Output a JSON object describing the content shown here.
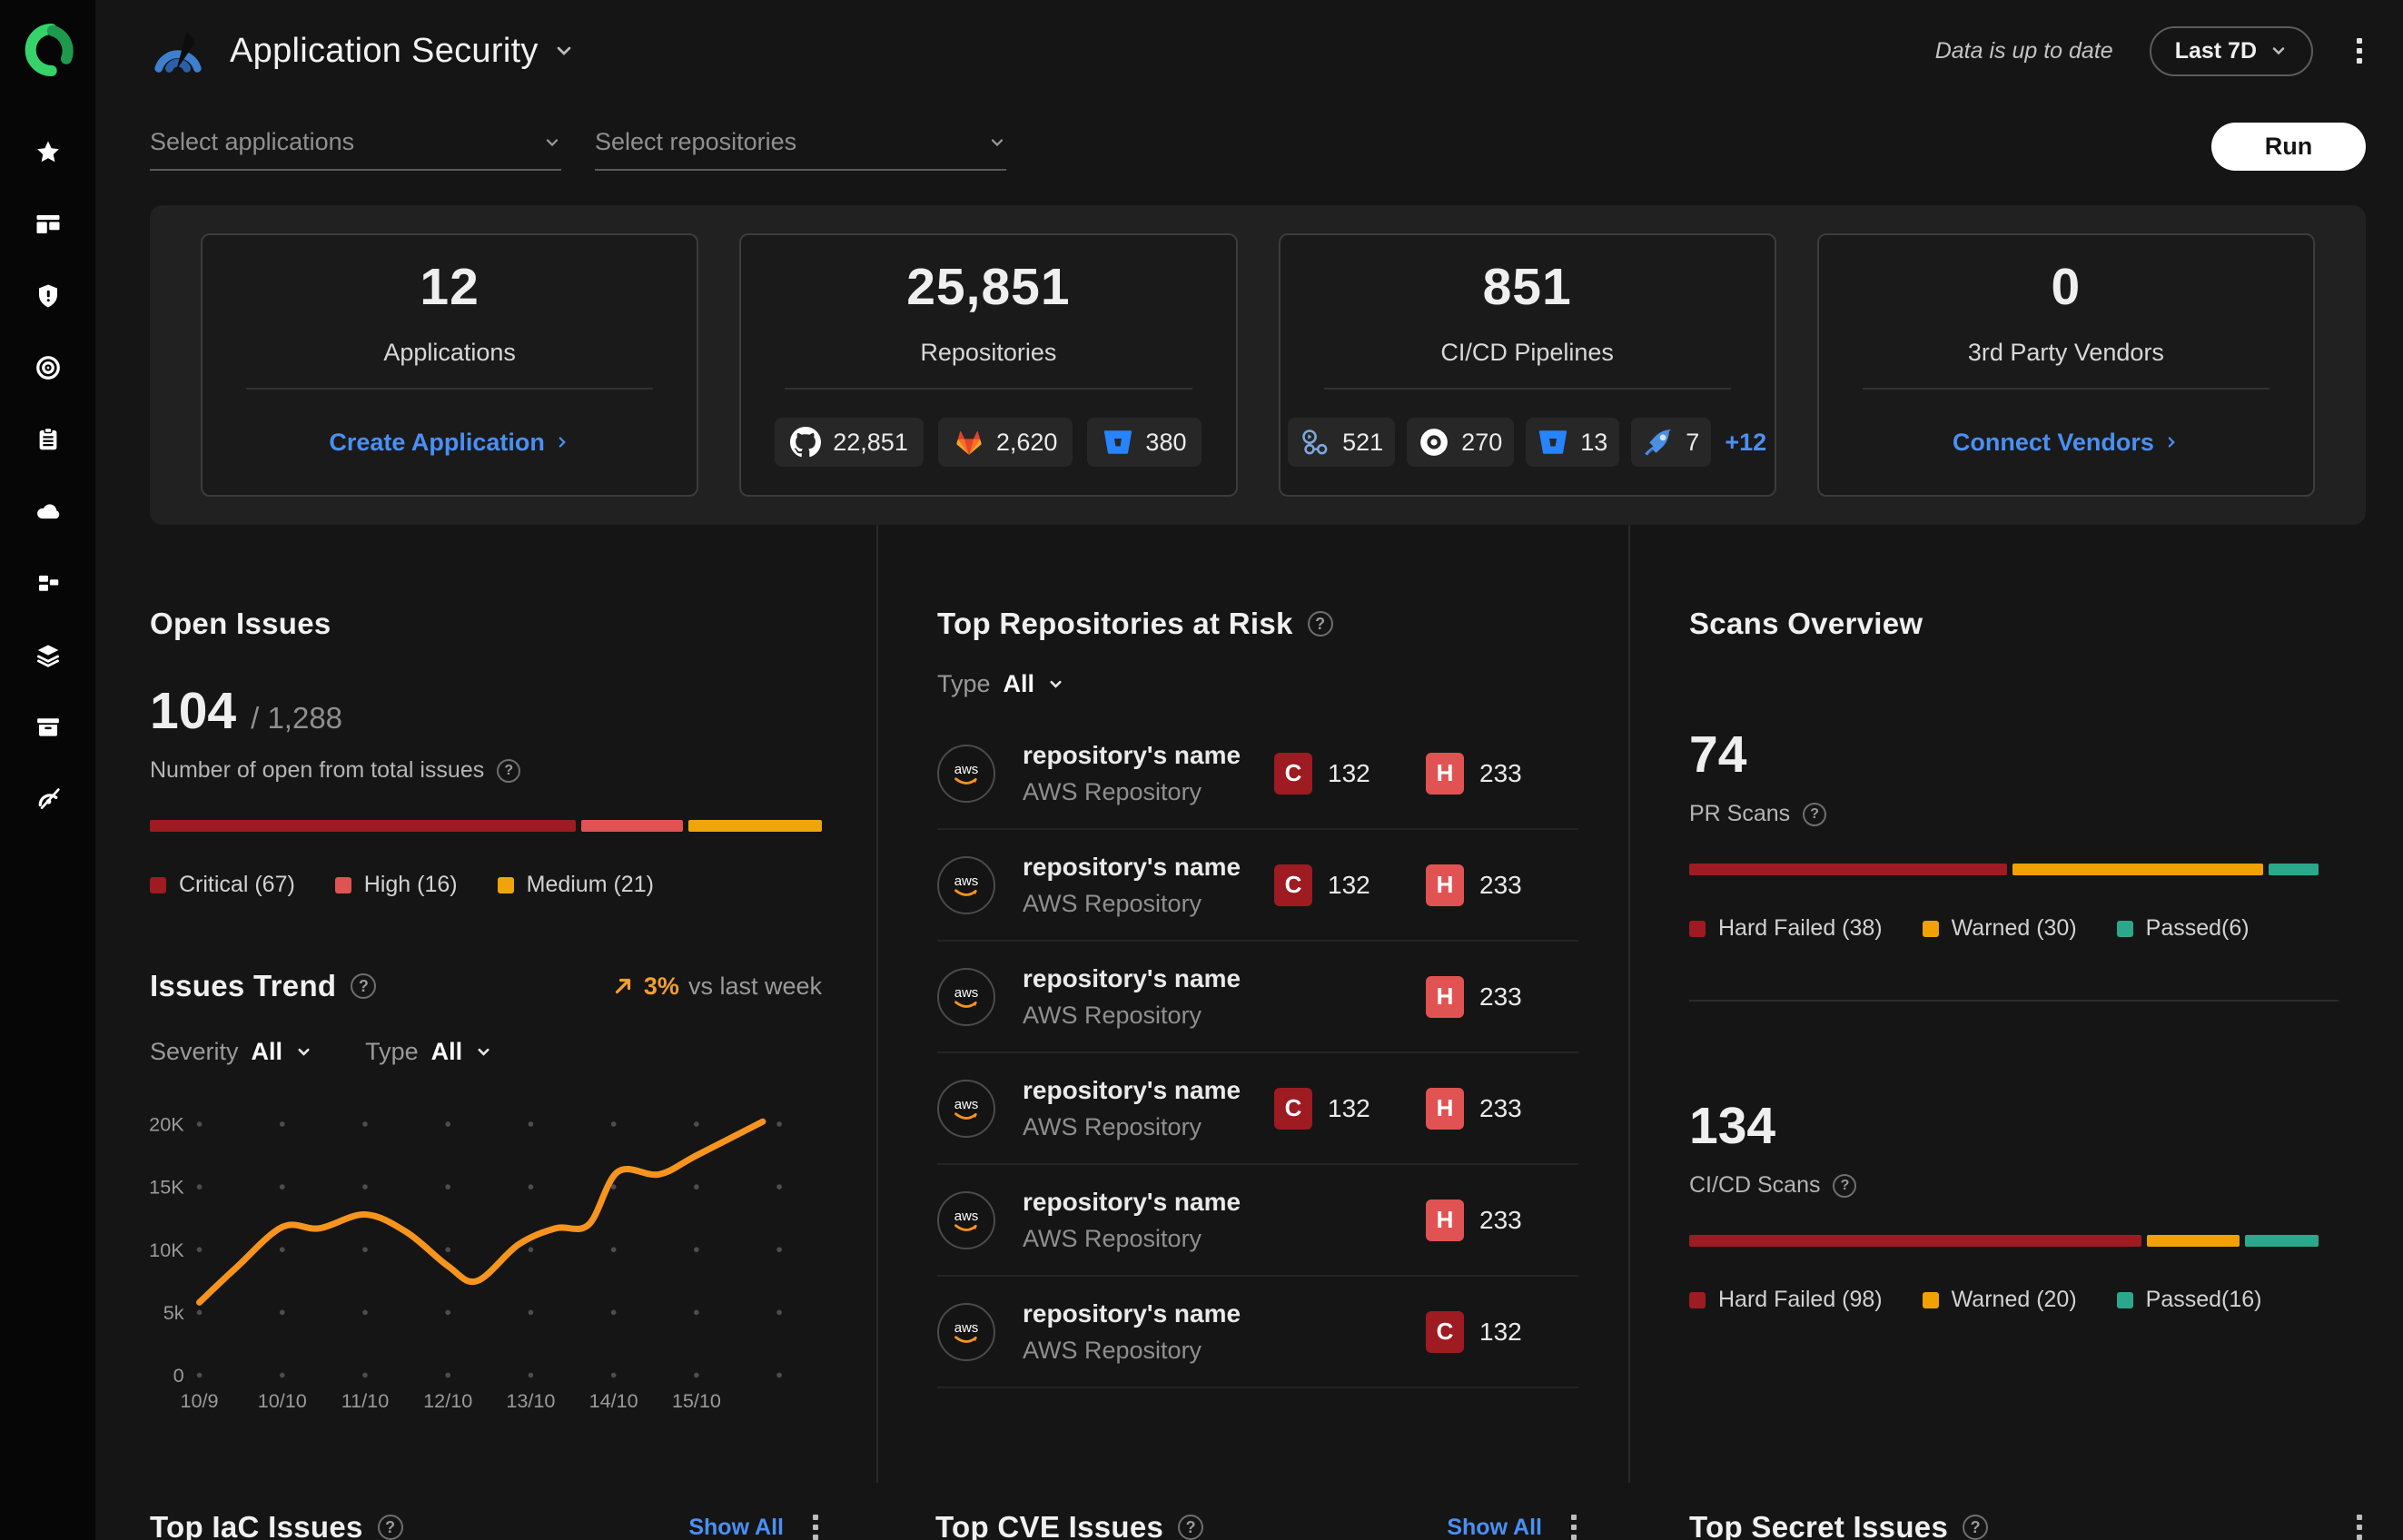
{
  "colors": {
    "accent_blue": "#4a90f4",
    "critical": "#9e1b21",
    "high": "#e05352",
    "medium": "#efa50a",
    "warned": "#f0a202",
    "passed": "#2ba88b",
    "trend_line": "#f7941d"
  },
  "sidebar": {
    "icons": [
      "logo",
      "star",
      "dashboard",
      "shield-alert",
      "target",
      "clipboard",
      "cloud",
      "blocks",
      "layers",
      "archive",
      "gauge"
    ]
  },
  "header": {
    "title": "Application Security",
    "status": "Data is up to date",
    "range": "Last 7D"
  },
  "filters": {
    "applications_placeholder": "Select applications",
    "repositories_placeholder": "Select repositories",
    "run_label": "Run"
  },
  "stats_cards": [
    {
      "value": "12",
      "label": "Applications",
      "action": "Create Application"
    },
    {
      "value": "25,851",
      "label": "Repositories",
      "chips": [
        {
          "icon": "github",
          "count": "22,851"
        },
        {
          "icon": "gitlab",
          "count": "2,620"
        },
        {
          "icon": "bitbucket",
          "count": "380"
        }
      ]
    },
    {
      "value": "851",
      "label": "CI/CD Pipelines",
      "chips": [
        {
          "icon": "github-actions",
          "count": "521"
        },
        {
          "icon": "circleci",
          "count": "270"
        },
        {
          "icon": "bitbucket-pipelines",
          "count": "13"
        },
        {
          "icon": "azure-pipelines",
          "count": "7"
        }
      ],
      "more": "+12"
    },
    {
      "value": "0",
      "label": "3rd Party Vendors",
      "action": "Connect Vendors"
    }
  ],
  "open_issues": {
    "title": "Open Issues",
    "open": "104",
    "total": "/ 1,288",
    "subtitle": "Number of open from total issues",
    "segments": [
      {
        "label": "Critical (67)",
        "count": 67,
        "color": "#9e1b21"
      },
      {
        "label": "High (16)",
        "count": 16,
        "color": "#e05352"
      },
      {
        "label": "Medium (21)",
        "count": 21,
        "color": "#efa50a"
      }
    ]
  },
  "issues_trend": {
    "title": "Issues Trend",
    "delta": "3%",
    "delta_suffix": "vs last week",
    "severity_label": "Severity",
    "severity_value": "All",
    "type_label": "Type",
    "type_value": "All"
  },
  "chart_data": {
    "type": "line",
    "title": "Issues Trend",
    "x_tick_labels": [
      "10/9",
      "10/10",
      "11/10",
      "12/10",
      "13/10",
      "14/10",
      "15/10"
    ],
    "y_tick_labels": [
      "0",
      "5k",
      "10K",
      "15K",
      "20K"
    ],
    "y_tick_values": [
      0,
      5000,
      10000,
      15000,
      20000
    ],
    "ylim": [
      0,
      20000
    ],
    "grid": "dotted",
    "legend_position": "none",
    "line_color": "#f7941d",
    "points": [
      {
        "x": 0,
        "y": 5800
      },
      {
        "x": 0.45,
        "y": 8600
      },
      {
        "x": 1,
        "y": 11800
      },
      {
        "x": 1.45,
        "y": 11700
      },
      {
        "x": 2,
        "y": 12800
      },
      {
        "x": 2.5,
        "y": 11400
      },
      {
        "x": 3,
        "y": 8700
      },
      {
        "x": 3.35,
        "y": 7500
      },
      {
        "x": 3.85,
        "y": 10400
      },
      {
        "x": 4.3,
        "y": 11700
      },
      {
        "x": 4.7,
        "y": 12000
      },
      {
        "x": 5.05,
        "y": 16200
      },
      {
        "x": 5.55,
        "y": 16000
      },
      {
        "x": 6,
        "y": 17500
      },
      {
        "x": 6.8,
        "y": 20200
      }
    ]
  },
  "top_repositories": {
    "title": "Top Repositories at Risk",
    "type_label": "Type",
    "type_value": "All",
    "rows": [
      {
        "name": "repository's name",
        "subtitle": "AWS Repository",
        "provider": "aws",
        "badges": [
          {
            "severity": "critical",
            "letter": "C",
            "count": "132"
          },
          {
            "severity": "high",
            "letter": "H",
            "count": "233"
          }
        ]
      },
      {
        "name": "repository's name",
        "subtitle": "AWS Repository",
        "provider": "aws",
        "badges": [
          {
            "severity": "critical",
            "letter": "C",
            "count": "132"
          },
          {
            "severity": "high",
            "letter": "H",
            "count": "233"
          }
        ]
      },
      {
        "name": "repository's name",
        "subtitle": "AWS Repository",
        "provider": "aws",
        "badges": [
          {
            "severity": "high",
            "letter": "H",
            "count": "233"
          }
        ]
      },
      {
        "name": "repository's name",
        "subtitle": "AWS Repository",
        "provider": "aws",
        "badges": [
          {
            "severity": "critical",
            "letter": "C",
            "count": "132"
          },
          {
            "severity": "high",
            "letter": "H",
            "count": "233"
          }
        ]
      },
      {
        "name": "repository's name",
        "subtitle": "AWS Repository",
        "provider": "aws",
        "badges": [
          {
            "severity": "high",
            "letter": "H",
            "count": "233"
          }
        ]
      },
      {
        "name": "repository's name",
        "subtitle": "AWS Repository",
        "provider": "aws",
        "badges": [
          {
            "severity": "critical",
            "letter": "C",
            "count": "132"
          }
        ]
      }
    ]
  },
  "scans_overview": {
    "title": "Scans Overview",
    "metrics": [
      {
        "value": "74",
        "label": "PR Scans",
        "segments": [
          {
            "label": "Hard Failed (38)",
            "count": 38,
            "color": "#9e1b21"
          },
          {
            "label": "Warned (30)",
            "count": 30,
            "color": "#f0a202"
          },
          {
            "label": "Passed(6)",
            "count": 6,
            "color": "#2ba88b"
          }
        ]
      },
      {
        "value": "134",
        "label": "CI/CD Scans",
        "segments": [
          {
            "label": "Hard Failed (98)",
            "count": 98,
            "color": "#9e1b21"
          },
          {
            "label": "Warned (20)",
            "count": 20,
            "color": "#f0a202"
          },
          {
            "label": "Passed(16)",
            "count": 16,
            "color": "#2ba88b"
          }
        ]
      }
    ]
  },
  "bottom_sections": [
    {
      "title": "Top IaC Issues",
      "show_all": "Show All"
    },
    {
      "title": "Top CVE Issues",
      "show_all": "Show All"
    },
    {
      "title": "Top Secret Issues"
    }
  ]
}
